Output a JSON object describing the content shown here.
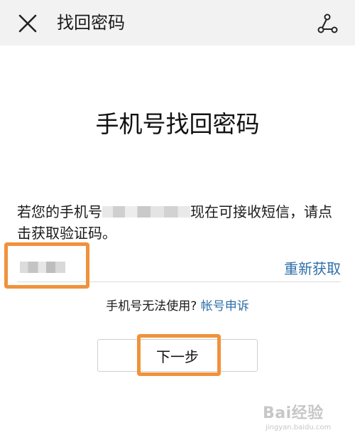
{
  "colors": {
    "topbar_bg": "#f2f2f2",
    "link": "#2f6fa8",
    "highlight": "#f0923b"
  },
  "topbar": {
    "close_icon": "close-icon",
    "title": "找回密码",
    "share_icon": "share-icon"
  },
  "main": {
    "heading": "手机号找回密码",
    "message_before": "若您的手机号",
    "message_after": "现在可接收短信，请点击获取验证码。",
    "resend_label": "重新获取",
    "help_text": "手机号无法使用?",
    "help_link": "帐号申诉",
    "next_label": "下一步"
  },
  "watermark": {
    "logo": "Bai经验",
    "sub": "jingyan.baidu.com"
  }
}
